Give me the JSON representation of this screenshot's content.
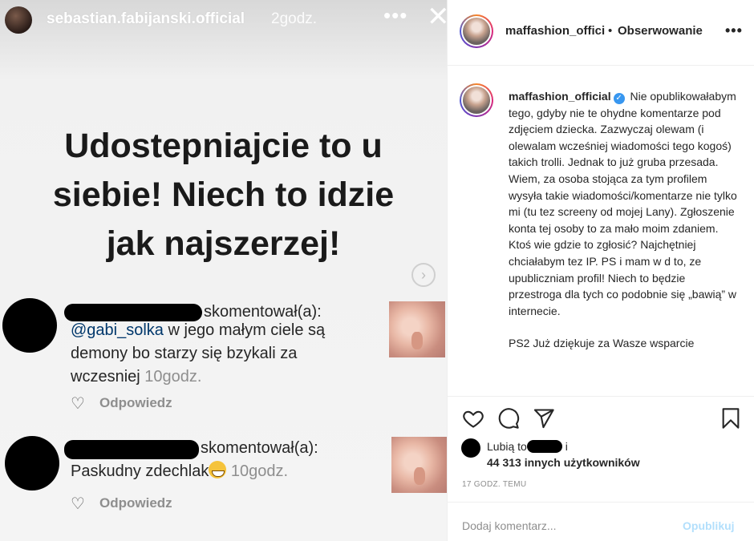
{
  "story": {
    "username": "sebastian.fabijanski.official",
    "time": "2godz.",
    "more_icon": "•••",
    "close_icon": "✕",
    "headline": [
      "Udostepniajcie to u",
      "siebie! Niech to idzie",
      "jak najszerzej!"
    ],
    "next_icon": "›",
    "comments": [
      {
        "action": "skomentował(a):",
        "mention": "@gabi_solka",
        "text_lines": [
          " w jego małym ciele są",
          "demony bo starzy się bzykali za",
          "wczesniej "
        ],
        "time": "10godz.",
        "reply": "Odpowiedz"
      },
      {
        "action": "skomentował(a):",
        "text": "Paskudny zdechlak",
        "time": "10godz.",
        "reply": "Odpowiedz"
      }
    ]
  },
  "post": {
    "username": "maffashion_offici",
    "separator": "•",
    "follow_label": "Obserwowanie",
    "more_icon": "•••",
    "caption_author": "maffashion_official",
    "verified_icon": "✓",
    "caption_text": "Nie opublikowałabym tego, gdyby nie te ohydne komentarze pod zdjęciem dziecka. Zazwyczaj olewam (i olewalam wcześniej wiadomości tego kogoś) takich trolli. Jednak to już gruba przesada. Wiem, za osoba stojąca za tym profilem wysyła takie wiadomości/komentarze nie tylko mi (tu tez screeny od mojej Lany). Zgłoszenie konta tej osoby to za mało moim zdaniem. Ktoś wie gdzie to zgłosić? Najchętniej chciałabym tez IP. PS i mam w d to, ze upubliczniam profil! Niech to będzie przestroga dla tych co podobnie się „bawią” w internecie.",
    "caption_text_2": "PS2 Już dziękuje za Wasze wsparcie",
    "likes_prefix": "Lubią to",
    "likes_and": " i",
    "likes_count": "44 313 innych użytkowników",
    "timestamp": "17 GODZ. TEMU",
    "comment_placeholder": "Dodaj komentarz...",
    "publish_label": "Opublikuj"
  }
}
